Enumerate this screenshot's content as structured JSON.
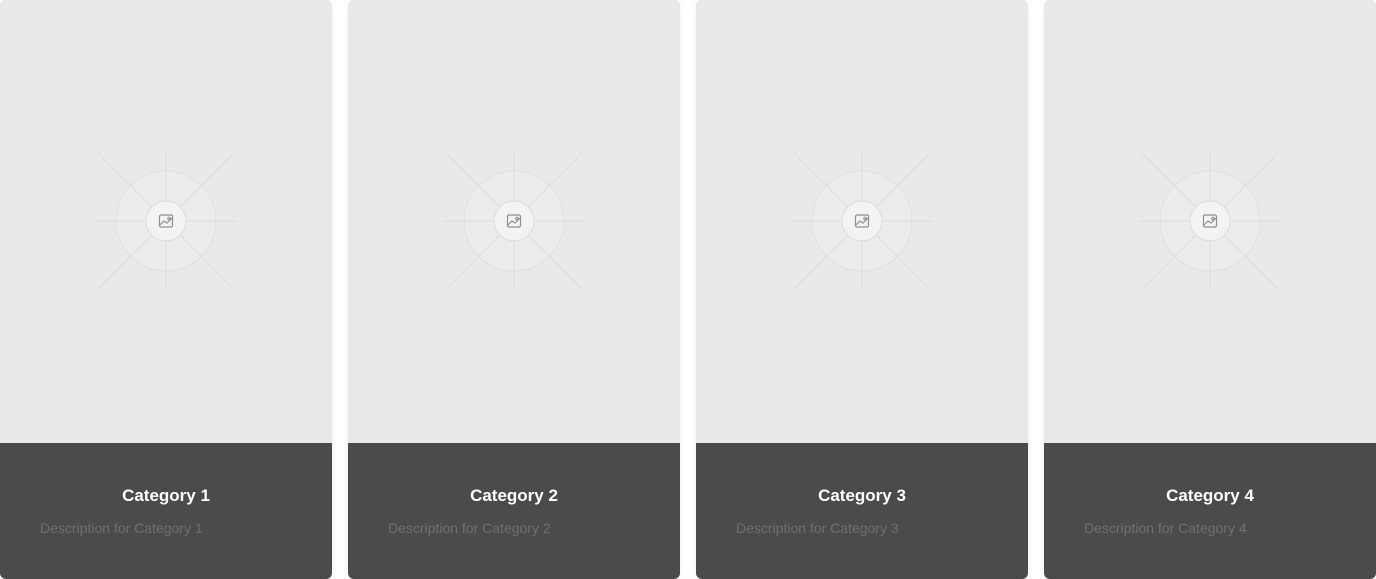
{
  "cards": [
    {
      "title": "Category 1",
      "description": "Description for Category 1",
      "image_icon": "image-placeholder-icon"
    },
    {
      "title": "Category 2",
      "description": "Description for Category 2",
      "image_icon": "image-placeholder-icon"
    },
    {
      "title": "Category 3",
      "description": "Description for Category 3",
      "image_icon": "image-placeholder-icon"
    },
    {
      "title": "Category 4",
      "description": "Description for Category 4",
      "image_icon": "image-placeholder-icon"
    }
  ],
  "colors": {
    "media_background": "#e9e9e9",
    "footer_background": "#4b4b4b",
    "title": "#ffffff",
    "description": "#6b6f7b"
  }
}
